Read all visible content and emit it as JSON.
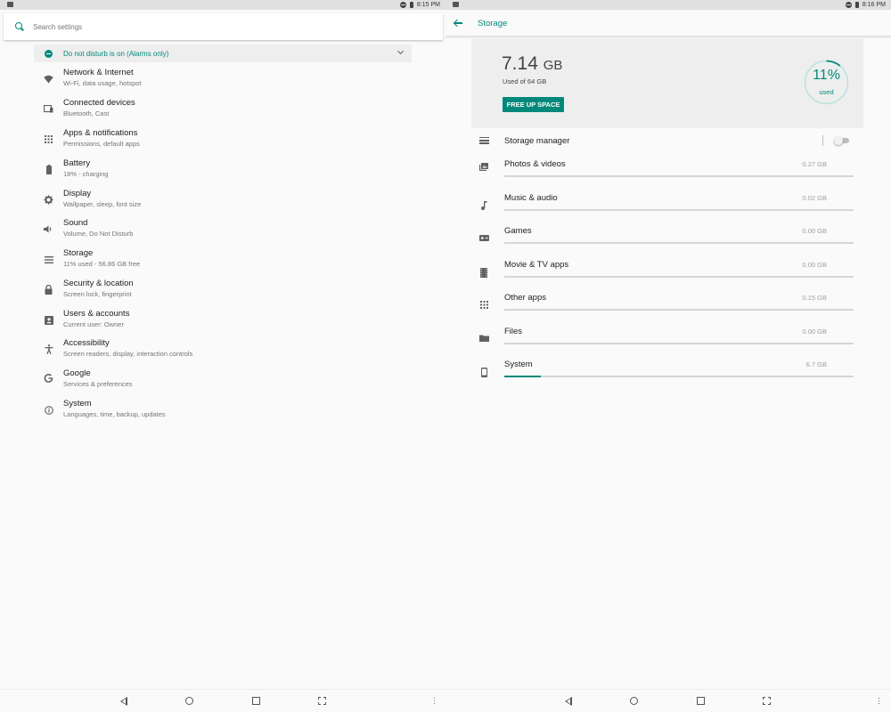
{
  "left_screen": {
    "status": {
      "time": "8:15 PM"
    },
    "search": {
      "placeholder": "Search settings"
    },
    "dnd_banner": "Do not disturb is on (Alarms only)",
    "items": [
      {
        "title": "Network & Internet",
        "subtitle": "Wi-Fi, data usage, hotspot",
        "icon": "wifi-icon"
      },
      {
        "title": "Connected devices",
        "subtitle": "Bluetooth, Cast",
        "icon": "devices-icon"
      },
      {
        "title": "Apps & notifications",
        "subtitle": "Permissions, default apps",
        "icon": "apps-icon"
      },
      {
        "title": "Battery",
        "subtitle": "18% - charging",
        "icon": "battery-icon"
      },
      {
        "title": "Display",
        "subtitle": "Wallpaper, sleep, font size",
        "icon": "brightness-icon"
      },
      {
        "title": "Sound",
        "subtitle": "Volume, Do Not Disturb",
        "icon": "volume-icon"
      },
      {
        "title": "Storage",
        "subtitle": "11% used - 56.86 GB free",
        "icon": "storage-icon"
      },
      {
        "title": "Security & location",
        "subtitle": "Screen lock, fingerprint",
        "icon": "lock-icon"
      },
      {
        "title": "Users & accounts",
        "subtitle": "Current user: Owner",
        "icon": "account-icon"
      },
      {
        "title": "Accessibility",
        "subtitle": "Screen readers, display, interaction controls",
        "icon": "accessibility-icon"
      },
      {
        "title": "Google",
        "subtitle": "Services & preferences",
        "icon": "google-icon"
      },
      {
        "title": "System",
        "subtitle": "Languages, time, backup, updates",
        "icon": "info-icon"
      }
    ]
  },
  "right_screen": {
    "status": {
      "time": "8:16 PM"
    },
    "title": "Storage",
    "summary": {
      "used_value": "7.14",
      "used_unit": "GB",
      "used_of": "Used of 64 GB",
      "free_up_label": "FREE UP SPACE",
      "percent_label": "11%",
      "percent_sub": "used",
      "percent_value": 0.11
    },
    "storage_manager": {
      "label": "Storage manager",
      "enabled": false
    },
    "categories": [
      {
        "name": "Photos & videos",
        "size": "0.27 GB",
        "fraction": 0.0,
        "icon": "photo-icon"
      },
      {
        "name": "Music & audio",
        "size": "0.02 GB",
        "fraction": 0.0,
        "icon": "music-note-icon"
      },
      {
        "name": "Games",
        "size": "0.00 GB",
        "fraction": 0.0,
        "icon": "gamepad-icon"
      },
      {
        "name": "Movie & TV apps",
        "size": "0.00 GB",
        "fraction": 0.0,
        "icon": "movie-icon"
      },
      {
        "name": "Other apps",
        "size": "0.15 GB",
        "fraction": 0.0,
        "icon": "apps-icon"
      },
      {
        "name": "Files",
        "size": "0.00 GB",
        "fraction": 0.0,
        "icon": "folder-icon"
      },
      {
        "name": "System",
        "size": "6.7 GB",
        "fraction": 0.105,
        "icon": "phone-icon"
      }
    ]
  },
  "colors": {
    "accent": "#00897b",
    "bar_track": "#d6d6d6"
  }
}
